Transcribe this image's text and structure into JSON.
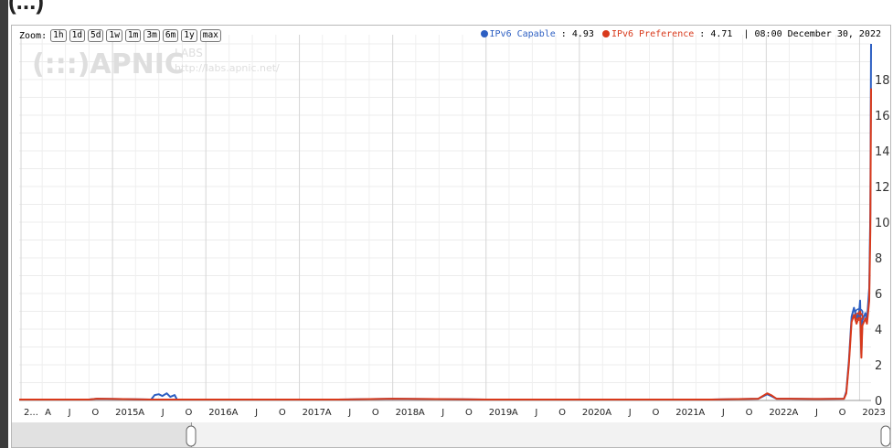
{
  "page": {
    "title_partial": "(...)"
  },
  "zoom": {
    "label": "Zoom:",
    "buttons": [
      "1h",
      "1d",
      "5d",
      "1w",
      "1m",
      "3m",
      "6m",
      "1y",
      "max"
    ]
  },
  "legend": {
    "capable_label": "IPv6 Capable",
    "capable_value": "4.93",
    "preference_label": "IPv6 Preference",
    "preference_value": "4.71",
    "timestamp": "08:00 December 30, 2022"
  },
  "watermark": {
    "logo": "(:::)APNIC",
    "labs": "LABS",
    "url": "http://labs.apnic.net/"
  },
  "chart_data": {
    "type": "line",
    "y_ticks": [
      0,
      2,
      4,
      6,
      8,
      10,
      12,
      14,
      16,
      18
    ],
    "ylim": [
      0,
      20
    ],
    "x_tick_labels": [
      "2...",
      "A",
      "J",
      "O",
      "2015",
      "A",
      "J",
      "O",
      "2016",
      "A",
      "J",
      "O",
      "2017",
      "A",
      "J",
      "O",
      "2018",
      "A",
      "J",
      "O",
      "2019",
      "A",
      "J",
      "O",
      "2020",
      "A",
      "J",
      "O",
      "2021",
      "A",
      "J",
      "O",
      "2022",
      "A",
      "J",
      "O",
      "2023"
    ],
    "x_range": [
      "2014-01-01",
      "2023-02-15"
    ],
    "grid": true,
    "series": [
      {
        "name": "IPv6 Capable",
        "color": "#2d5fc2",
        "x": [
          "2014-01-01",
          "2014-10-01",
          "2014-11-01",
          "2015-06-01",
          "2015-06-15",
          "2015-07-01",
          "2015-07-15",
          "2015-08-01",
          "2015-08-15",
          "2015-09-01",
          "2015-09-10",
          "2016-06-01",
          "2017-06-01",
          "2018-01-01",
          "2019-01-01",
          "2020-01-01",
          "2021-06-01",
          "2021-12-01",
          "2022-01-05",
          "2022-01-20",
          "2022-02-10",
          "2022-04-01",
          "2022-08-01",
          "2022-11-01",
          "2022-11-10",
          "2022-11-20",
          "2022-12-01",
          "2022-12-10",
          "2022-12-20",
          "2022-12-30",
          "2023-01-03",
          "2023-01-08",
          "2023-01-12",
          "2023-01-18",
          "2023-01-24",
          "2023-01-30",
          "2023-02-04",
          "2023-02-08",
          "2023-02-12",
          "2023-02-15"
        ],
        "values": [
          0.05,
          0.05,
          0.1,
          0.05,
          0.3,
          0.35,
          0.25,
          0.4,
          0.2,
          0.3,
          0.05,
          0.05,
          0.05,
          0.1,
          0.05,
          0.05,
          0.05,
          0.1,
          0.35,
          0.25,
          0.1,
          0.1,
          0.08,
          0.1,
          0.5,
          2.2,
          4.7,
          5.2,
          4.6,
          4.93,
          5.6,
          2.6,
          4.5,
          4.7,
          4.9,
          4.5,
          5.5,
          6.3,
          10.5,
          20.0
        ]
      },
      {
        "name": "IPv6 Preference",
        "color": "#d8391b",
        "x": [
          "2014-01-01",
          "2014-10-01",
          "2014-11-01",
          "2015-06-01",
          "2016-06-01",
          "2017-06-01",
          "2018-01-01",
          "2019-01-01",
          "2020-01-01",
          "2021-06-01",
          "2021-12-01",
          "2022-01-05",
          "2022-01-20",
          "2022-02-10",
          "2022-04-01",
          "2022-08-01",
          "2022-11-01",
          "2022-11-10",
          "2022-11-20",
          "2022-12-01",
          "2022-12-10",
          "2022-12-20",
          "2022-12-30",
          "2023-01-03",
          "2023-01-08",
          "2023-01-12",
          "2023-01-18",
          "2023-01-24",
          "2023-01-30",
          "2023-02-04",
          "2023-02-08",
          "2023-02-12",
          "2023-02-15"
        ],
        "values": [
          0.05,
          0.05,
          0.1,
          0.05,
          0.05,
          0.05,
          0.1,
          0.05,
          0.05,
          0.05,
          0.1,
          0.4,
          0.3,
          0.1,
          0.1,
          0.08,
          0.1,
          0.4,
          2.0,
          4.4,
          4.8,
          4.3,
          4.71,
          5.0,
          2.4,
          4.2,
          4.4,
          4.6,
          4.3,
          5.0,
          5.6,
          9.5,
          17.5
        ]
      }
    ]
  }
}
